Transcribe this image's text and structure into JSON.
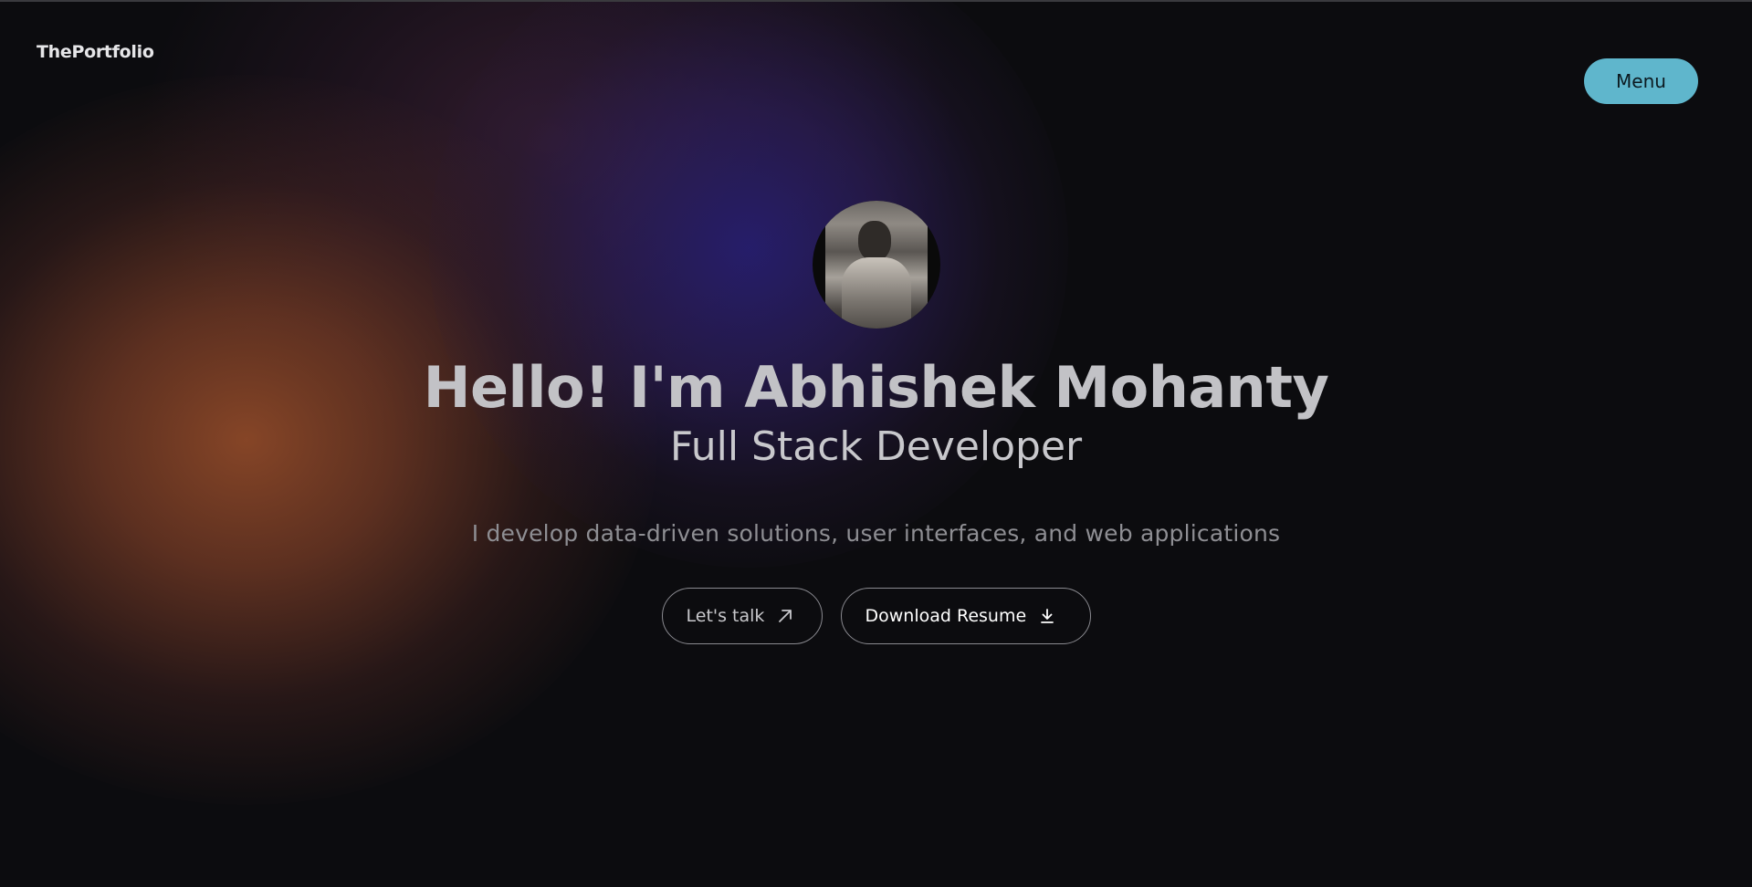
{
  "header": {
    "brand": "ThePortfolio",
    "menu_label": "Menu"
  },
  "hero": {
    "avatar_alt": "profile photo",
    "headline": "Hello! I'm Abhishek Mohanty",
    "role": "Full Stack Developer",
    "tagline": "I develop data-driven solutions, user interfaces, and web applications",
    "talk_button": {
      "label": "Let's talk",
      "icon": "arrow-up-right-icon"
    },
    "resume_button": {
      "label": "Download Resume",
      "icon": "download-icon"
    }
  },
  "colors": {
    "background": "#0c0c0f",
    "menu_button": "#5fb6cc",
    "glow_orange": "#8c4828",
    "glow_blue": "#261e6e",
    "heading_text": "#c2c2c6",
    "muted_text": "#8e8e93"
  }
}
